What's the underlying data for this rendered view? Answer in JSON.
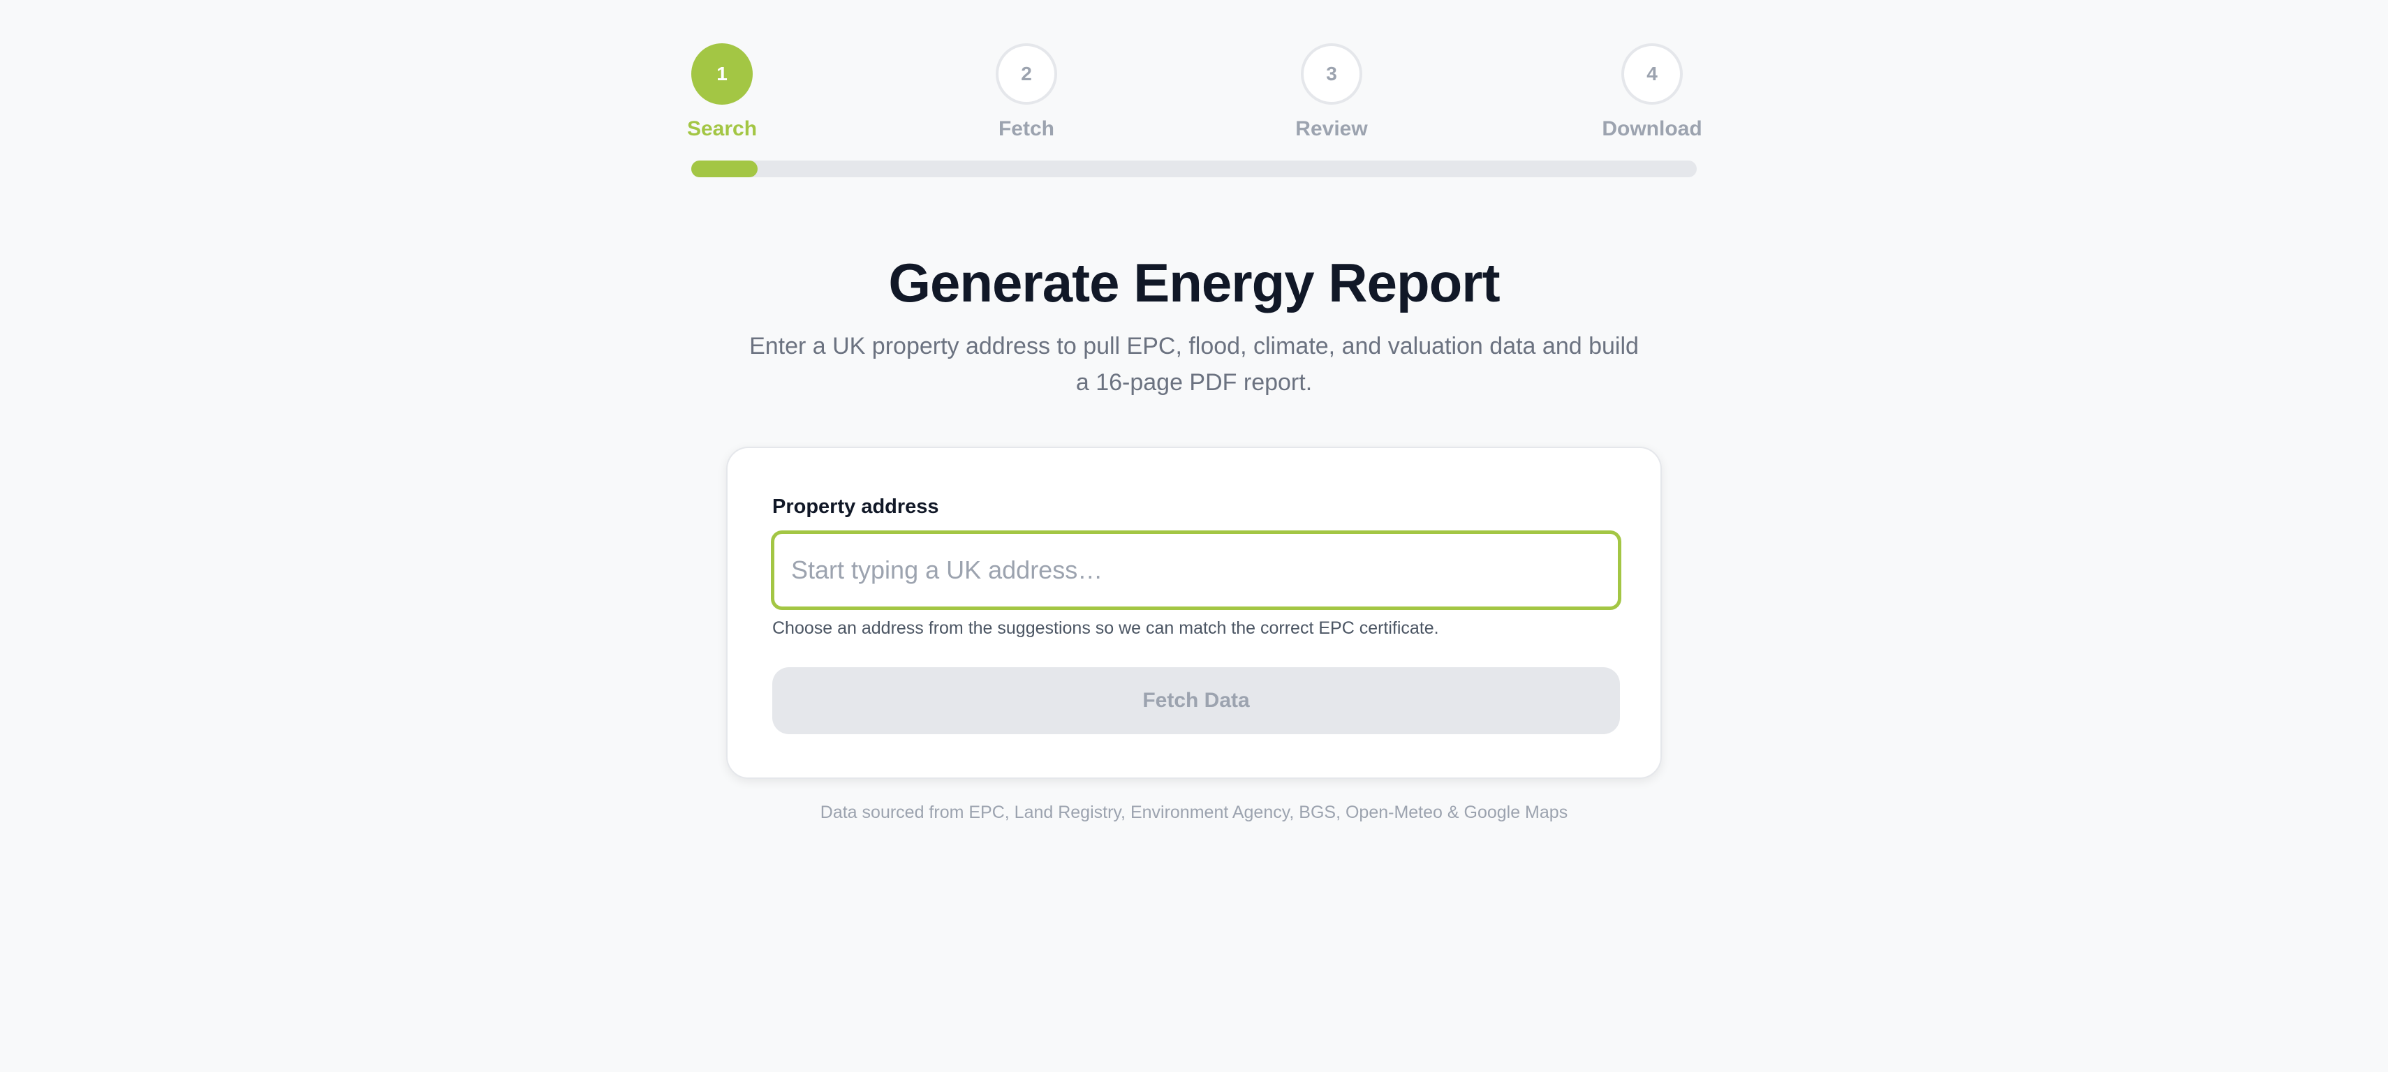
{
  "colors": {
    "accent": "#a3c644"
  },
  "stepper": {
    "steps": [
      {
        "number": "1",
        "label": "Search",
        "state": "active"
      },
      {
        "number": "2",
        "label": "Fetch",
        "state": "pending"
      },
      {
        "number": "3",
        "label": "Review",
        "state": "pending"
      },
      {
        "number": "4",
        "label": "Download",
        "state": "pending"
      }
    ],
    "progress_fraction": 0.066
  },
  "header": {
    "title": "Generate Energy Report",
    "subtitle": "Enter a UK property address to pull EPC, flood, climate, and valuation data and build a 16-page PDF report."
  },
  "form": {
    "address_label": "Property address",
    "address_value": "",
    "address_placeholder": "Start typing a UK address…",
    "hint": "Choose an address from the suggestions so we can match the correct EPC certificate.",
    "fetch_label": "Fetch Data",
    "fetch_disabled": true
  },
  "footer": {
    "sources": "Data sourced from EPC, Land Registry, Environment Agency, BGS, Open-Meteo & Google Maps"
  }
}
